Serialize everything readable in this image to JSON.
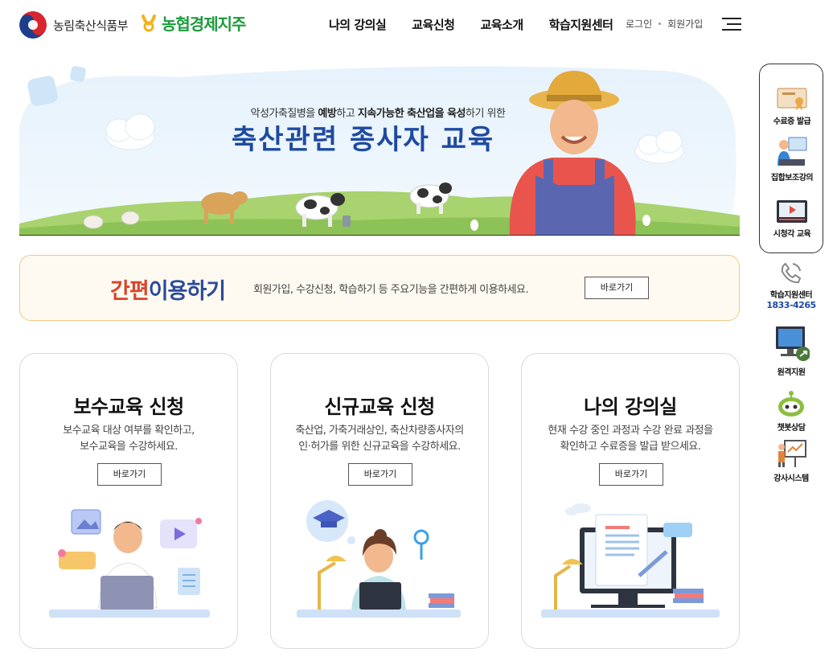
{
  "header": {
    "gov_logo_text": "농림축산식품부",
    "nh_logo_text": "농협경제지주",
    "nav": [
      "나의 강의실",
      "교육신청",
      "교육소개",
      "학습지원센터"
    ],
    "login": "로그인",
    "signup": "회원가입"
  },
  "banner": {
    "subtitle_parts": [
      "악성가축질병을 ",
      "예방",
      "하고 ",
      "지속가능한 축산업을 ",
      "육성",
      "하기 위한"
    ],
    "title": "축산관련 종사자 교육"
  },
  "easy": {
    "title_part1": "간편",
    "title_part2": "이용하기",
    "desc": "회원가입, 수강신청, 학습하기 등 주요기능을 간편하게 이용하세요.",
    "button": "바로가기"
  },
  "cards": [
    {
      "title": "보수교육 신청",
      "desc_line1": "보수교육 대상 여부를 확인하고,",
      "desc_line2": "보수교육을 수강하세요.",
      "button": "바로가기"
    },
    {
      "title": "신규교육 신청",
      "desc_line1": "축산업, 가축거래상인, 축산차량종사자의",
      "desc_line2": "인·허가를 위한 신규교육을 수강하세요.",
      "button": "바로가기"
    },
    {
      "title": "나의 강의실",
      "desc_line1": "현재 수강 중인 과정과 수강 완료 과정을",
      "desc_line2": "확인하고 수료증을 발급 받으세요.",
      "button": "바로가기"
    }
  ],
  "quick_menu": {
    "items": [
      "수료증 발급",
      "집합보조강의",
      "시청각 교육"
    ]
  },
  "side": {
    "support_label": "학습지원센터",
    "support_phone": "1833-4265",
    "remote": "원격지원",
    "chatbot": "챗봇상담",
    "instructor": "강사시스템"
  },
  "colors": {
    "brand_green": "#1a9b3c",
    "title_blue": "#1e4aa0",
    "accent_red": "#d9442b",
    "easy_border": "#f0c98a"
  }
}
